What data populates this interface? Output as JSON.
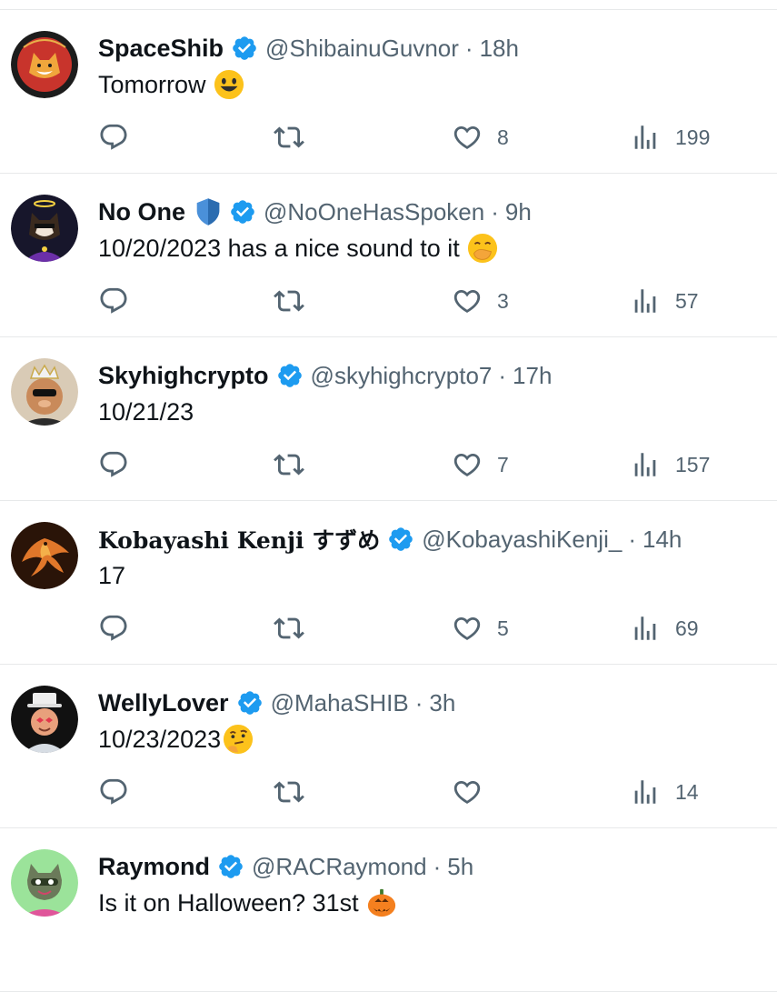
{
  "tweets": [
    {
      "name": "SpaceShib",
      "handle": "@ShibainuGuvnor",
      "sep": "·",
      "time": "18h",
      "text": "Tomorrow",
      "emoji": "smiley-face-icon",
      "replies": "",
      "retweets": "",
      "likes": "8",
      "views": "199",
      "verified": true
    },
    {
      "name": "No One",
      "handle": "@NoOneHasSpoken",
      "sep": "·",
      "time": "9h",
      "text": "10/20/2023 has a nice sound to it",
      "emoji": "hand-over-mouth-face-icon",
      "replies": "",
      "retweets": "",
      "likes": "3",
      "views": "57",
      "verified": true,
      "extra_badge": "shield-icon"
    },
    {
      "name": "Skyhighcrypto",
      "handle": "@skyhighcrypto7",
      "sep": "·",
      "time": "17h",
      "text": "10/21/23",
      "emoji": "",
      "replies": "",
      "retweets": "",
      "likes": "7",
      "views": "157",
      "verified": true
    },
    {
      "name": "Kobayashi Kenji すずめ",
      "handle": "@KobayashiKenji_",
      "sep": "·",
      "time": "14h",
      "text": "17",
      "emoji": "",
      "replies": "",
      "retweets": "",
      "likes": "5",
      "views": "69",
      "verified": true
    },
    {
      "name": "WellyLover",
      "handle": "@MahaSHIB",
      "sep": "·",
      "time": "3h",
      "text": "10/23/2023",
      "emoji": "thinking-face-icon",
      "replies": "",
      "retweets": "",
      "likes": "",
      "views": "14",
      "verified": true
    },
    {
      "name": "Raymond",
      "handle": "@RACRaymond",
      "sep": "·",
      "time": "5h",
      "text": "Is it on Halloween? 31st",
      "emoji": "jack-o-lantern-icon",
      "verified": true
    }
  ],
  "colors": {
    "verified": "#1d9bf0",
    "muted": "#536471",
    "text": "#0f1419",
    "divider": "#e7e9ea"
  }
}
